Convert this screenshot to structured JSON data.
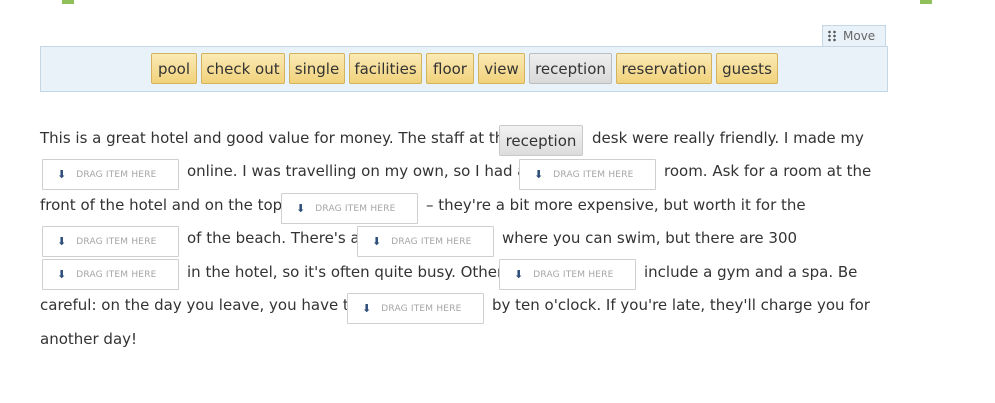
{
  "move_label": "Move",
  "chips": [
    "pool",
    "check out",
    "single",
    "facilities",
    "floor",
    "view",
    "reception",
    "reservation",
    "guests"
  ],
  "drop_label": "DRAG ITEM HERE",
  "placed_word": "reception",
  "text": {
    "l1a": "This is a great hotel and good value for money. The staff at the",
    "l1b": "desk were really friendly. I made my",
    "l2a": "online. I was travelling on my own, so I had a",
    "l2b": "room. Ask for a room at the",
    "l3a": "front of the hotel and on the top",
    "l3b": "– they're a bit more expensive, but worth it for the",
    "l4a": "of the beach. There's a",
    "l4b": "where you can swim, but there are 300",
    "l5a": "in the hotel, so it's often quite busy. Other",
    "l5b": "include a gym and a spa. Be",
    "l6a": "careful: on the day you leave, you have to",
    "l6b": "by ten o'clock. If you're late, they'll charge you for",
    "l7": "another day!"
  }
}
